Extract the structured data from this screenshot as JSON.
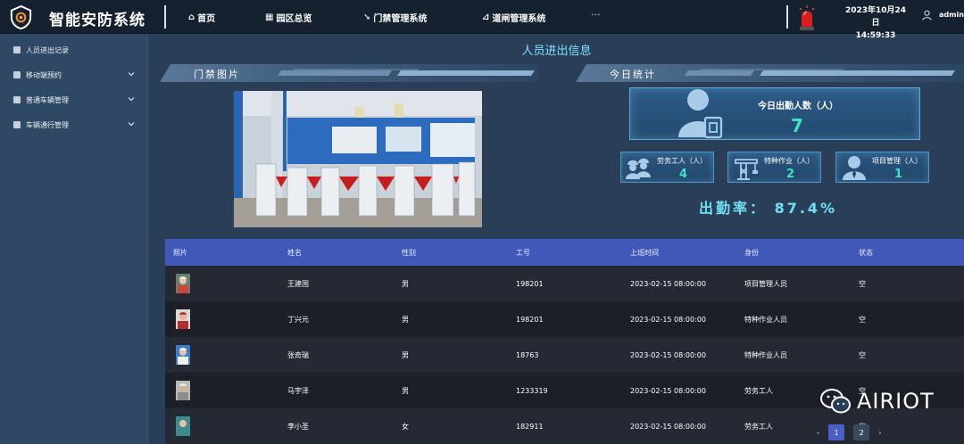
{
  "app": {
    "title": "智能安防系统"
  },
  "nav": [
    {
      "icon": "home-icon",
      "label": "首页"
    },
    {
      "icon": "building-icon",
      "label": "园区总览"
    },
    {
      "icon": "gate-icon",
      "label": "门禁管理系统"
    },
    {
      "icon": "barrier-icon",
      "label": "道闸管理系统"
    }
  ],
  "nav_more": "···",
  "header": {
    "date": "2023年10月24日",
    "time": "14:59:33",
    "username": "admin"
  },
  "sidebar": {
    "items": [
      {
        "label": "人员进出记录",
        "expandable": false
      },
      {
        "label": "移动端预约",
        "expandable": true
      },
      {
        "label": "普通车辆管理",
        "expandable": true
      },
      {
        "label": "车辆通行管理",
        "expandable": true
      }
    ]
  },
  "main": {
    "title": "人员进出信息",
    "gate_section": {
      "label": "门禁图片"
    },
    "stats_section": {
      "label": "今日统计"
    },
    "stats": {
      "total_label": "今日出勤人数（人）",
      "total_value": "7",
      "cards": [
        {
          "icon": "workers-icon",
          "label": "劳务工人（人）",
          "value": "4"
        },
        {
          "icon": "crane-icon",
          "label": "特种作业（人）",
          "value": "2"
        },
        {
          "icon": "manager-icon",
          "label": "项目管理（人）",
          "value": "1"
        }
      ],
      "attendance_text": "出勤率：  87.4%"
    },
    "table": {
      "headers": [
        "照片",
        "姓名",
        "性别",
        "工号",
        "上班时间",
        "身份",
        "状态"
      ],
      "rows": [
        {
          "name": "王建国",
          "gender": "男",
          "id": "198201",
          "time": "2023-02-15 08:00:00",
          "role": "项目管理人员",
          "status": "空"
        },
        {
          "name": "丁兴元",
          "gender": "男",
          "id": "198201",
          "time": "2023-02-15 08:00:00",
          "role": "特种作业人员",
          "status": "空"
        },
        {
          "name": "张奇瑞",
          "gender": "男",
          "id": "18763",
          "time": "2023-02-15 08:00:00",
          "role": "特种作业人员",
          "status": "空"
        },
        {
          "name": "马宇泽",
          "gender": "男",
          "id": "1233319",
          "time": "2023-02-15 08:00:00",
          "role": "劳务工人",
          "status": "空"
        },
        {
          "name": "李小圣",
          "gender": "女",
          "id": "182911",
          "time": "2023-02-15 08:00:00",
          "role": "劳务工人",
          "status": "空"
        }
      ]
    },
    "pager": {
      "prev": "‹",
      "pages": [
        "1",
        "2"
      ],
      "next": "›",
      "current": "1"
    }
  },
  "watermark": {
    "text": "AIRIOT"
  },
  "colors": {
    "accent": "#4158b8",
    "value": "#3de3c6",
    "title": "#7fe1ff"
  }
}
